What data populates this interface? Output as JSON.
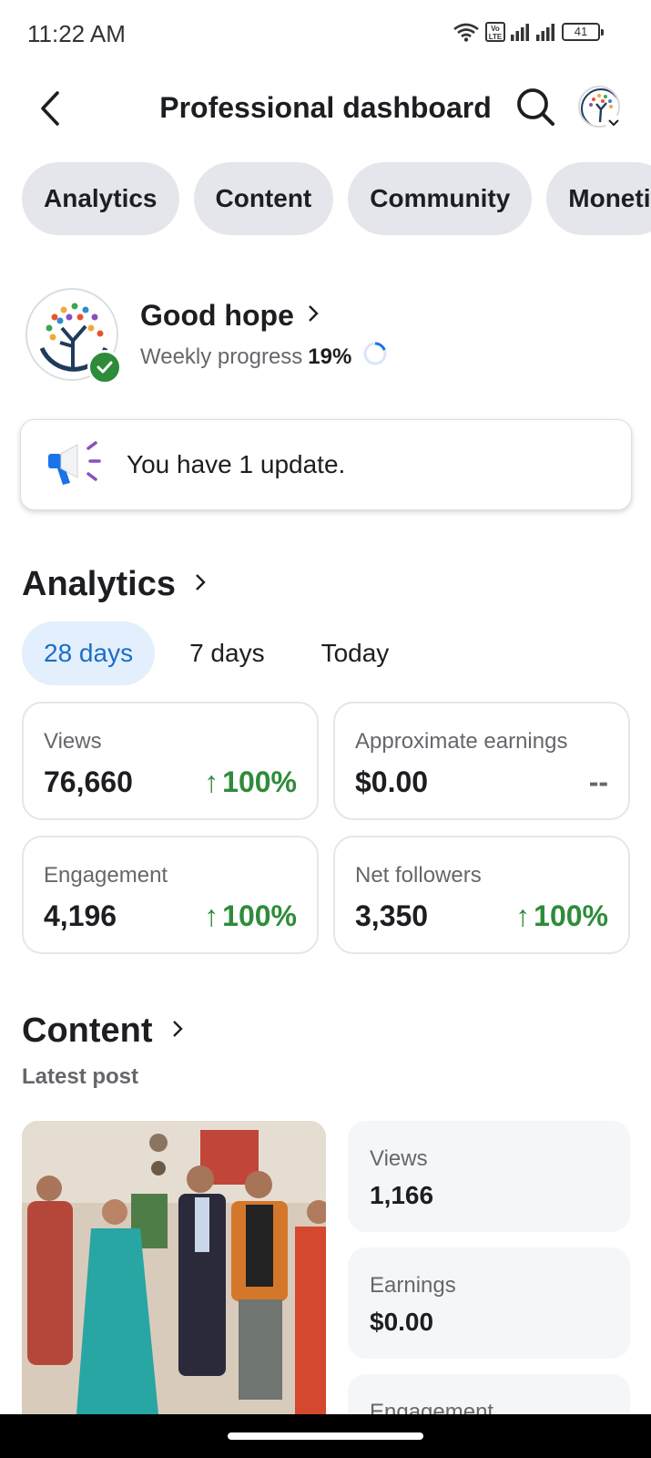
{
  "status_bar": {
    "time": "11:22 AM",
    "volte": "Vo LTE",
    "battery": "41",
    "icons": [
      "wifi-icon",
      "volte-icon",
      "signal-icon",
      "signal-icon",
      "battery-icon"
    ]
  },
  "header": {
    "title": "Professional dashboard",
    "back_icon": "back-arrow-icon",
    "search_icon": "search-icon",
    "profile_icon": "avatar"
  },
  "tabs": [
    {
      "label": "Analytics"
    },
    {
      "label": "Content"
    },
    {
      "label": "Community"
    },
    {
      "label": "Moneti"
    }
  ],
  "profile": {
    "name": "Good hope",
    "progress_label": "Weekly progress",
    "progress_value": "19%",
    "progress_fraction": 0.19,
    "verified": true
  },
  "update": {
    "text": "You have 1 update."
  },
  "analytics": {
    "title": "Analytics",
    "ranges": [
      {
        "label": "28 days",
        "active": true
      },
      {
        "label": "7 days",
        "active": false
      },
      {
        "label": "Today",
        "active": false
      }
    ],
    "metrics": [
      {
        "label": "Views",
        "value": "76,660",
        "change": "100%",
        "arrow": "↑"
      },
      {
        "label": "Approximate earnings",
        "value": "$0.00",
        "change": "--",
        "arrow": ""
      },
      {
        "label": "Engagement",
        "value": "4,196",
        "change": "100%",
        "arrow": "↑"
      },
      {
        "label": "Net followers",
        "value": "3,350",
        "change": "100%",
        "arrow": "↑"
      }
    ]
  },
  "content": {
    "title": "Content",
    "subtitle": "Latest post",
    "stats": [
      {
        "label": "Views",
        "value": "1,166"
      },
      {
        "label": "Earnings",
        "value": "$0.00"
      },
      {
        "label": "Engagement",
        "value": ""
      }
    ]
  },
  "colors": {
    "accent_blue": "#1a6ec7",
    "positive_green": "#2e8b3a",
    "chip_bg": "#e4e6eb",
    "active_range_bg": "#e3effd"
  }
}
